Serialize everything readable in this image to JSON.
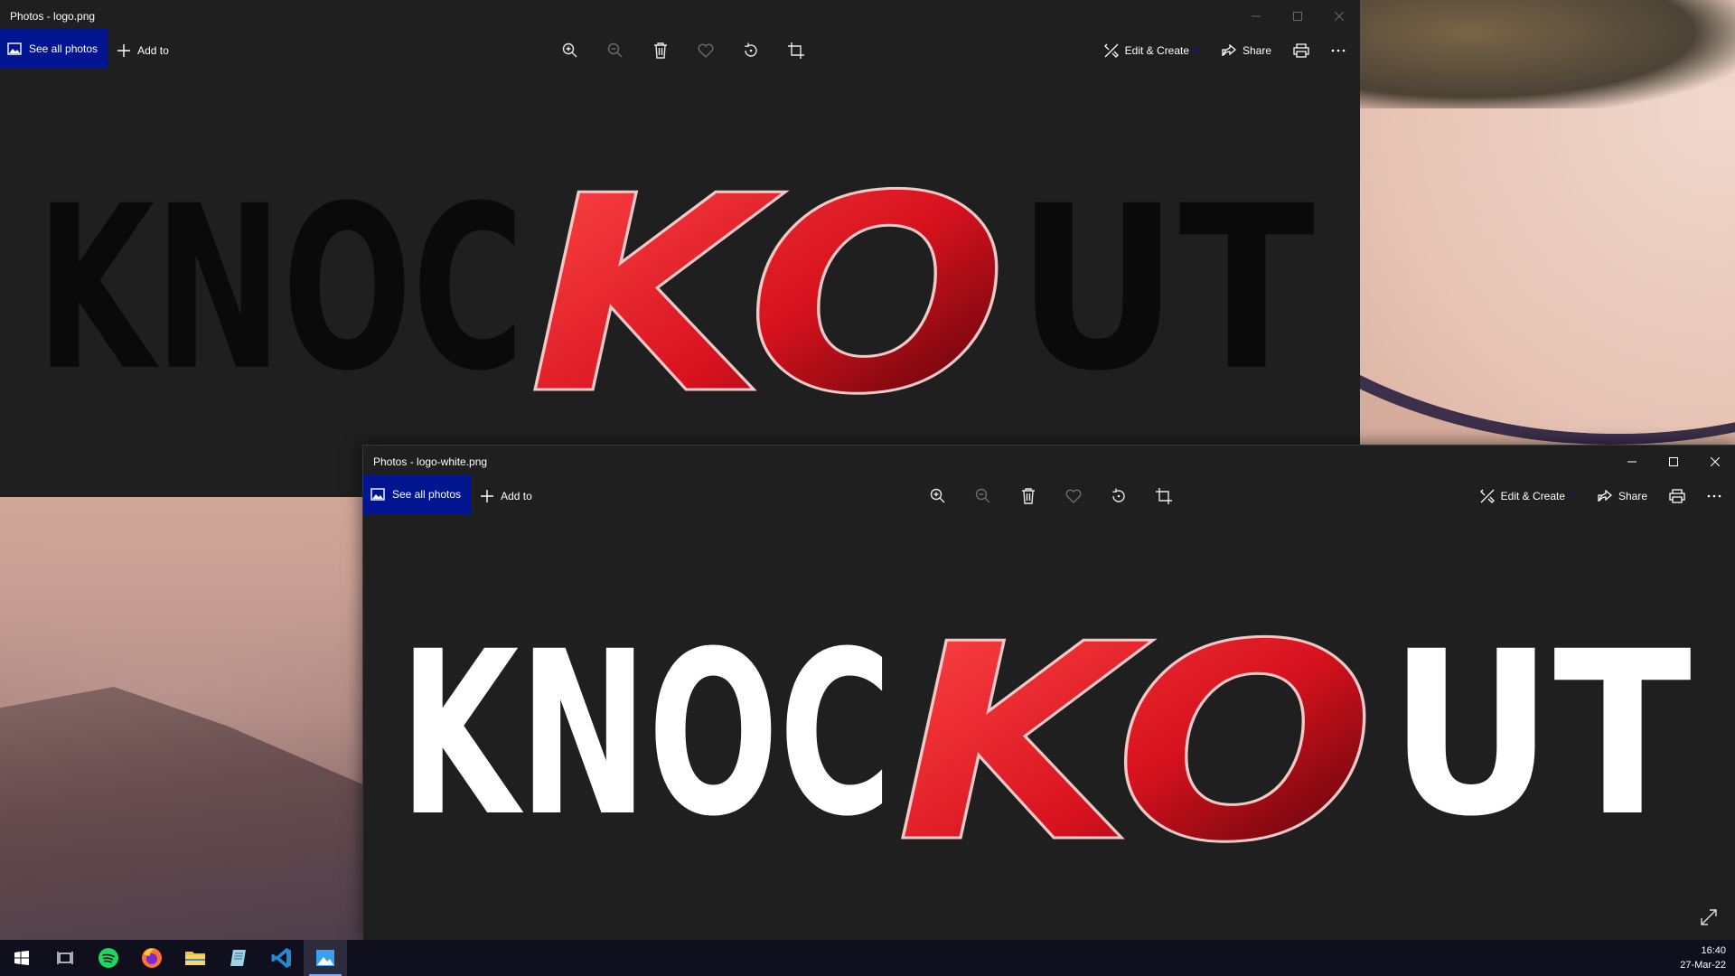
{
  "windows": {
    "back": {
      "title": "Photos - logo.png",
      "see_all": "See all photos",
      "add_to": "Add to",
      "edit_create": "Edit & Create",
      "share": "Share",
      "logo_left": "KNOC",
      "logo_mid": "KO",
      "logo_right": "UT"
    },
    "front": {
      "title": "Photos - logo-white.png",
      "see_all": "See all photos",
      "add_to": "Add to",
      "edit_create": "Edit & Create",
      "share": "Share",
      "logo_left": "KNOC",
      "logo_mid": "KO",
      "logo_right": "UT"
    }
  },
  "taskbar": {
    "apps": [
      "start-icon",
      "task-view-icon",
      "spotify-icon",
      "firefox-icon",
      "file-explorer-icon",
      "notepad-icon",
      "vscode-icon",
      "photos-icon"
    ],
    "time": "16:40",
    "date": "27-Mar-22"
  },
  "colors": {
    "accent": "#00158f",
    "window_bg": "#1f1f1f",
    "logo_red": "#e0242f",
    "taskbar": "#0f0f1e"
  }
}
